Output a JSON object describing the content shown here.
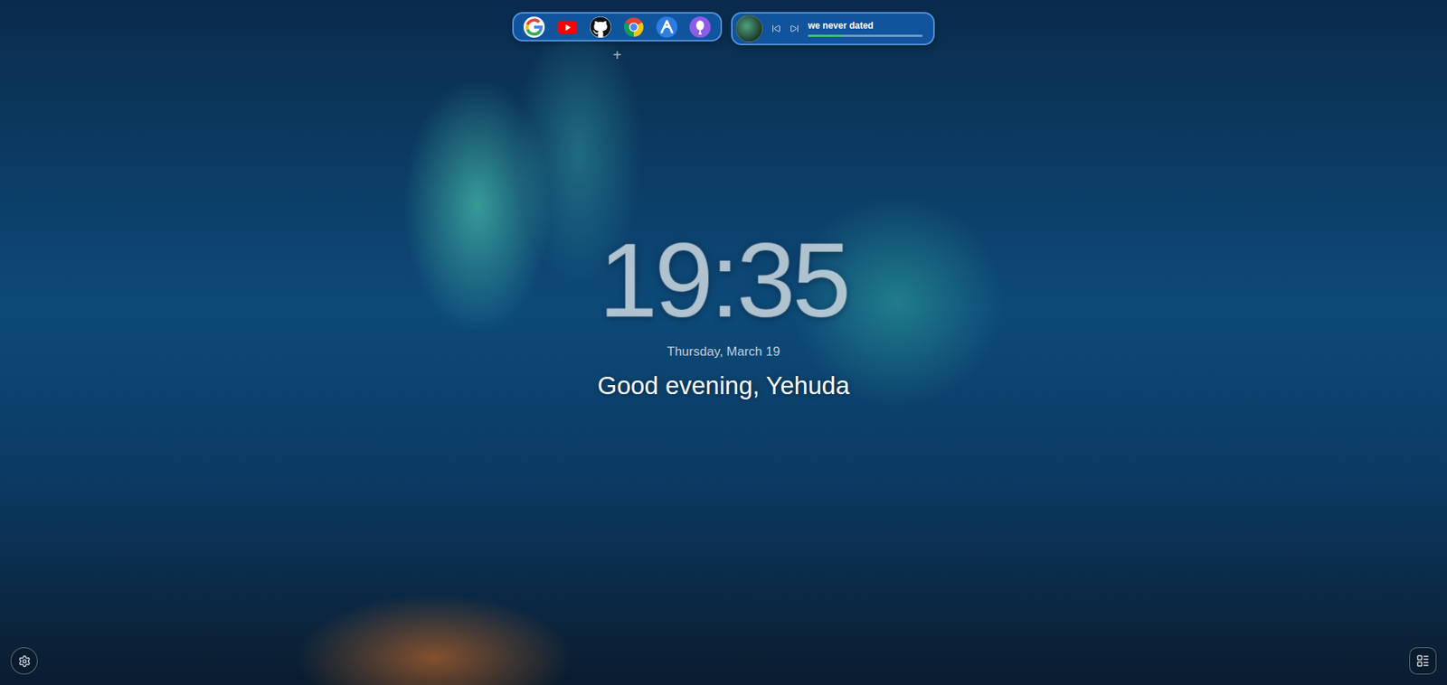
{
  "shortcuts": [
    {
      "kind": "google"
    },
    {
      "kind": "youtube"
    },
    {
      "kind": "github"
    },
    {
      "kind": "chrome"
    },
    {
      "kind": "arc"
    },
    {
      "kind": "balloon"
    }
  ],
  "add_button": "+",
  "music": {
    "title": "we never dated",
    "level": 0.3
  },
  "clock": {
    "time": "19:35",
    "date": "Thursday, March 19",
    "greeting": "Good evening, Yehuda"
  }
}
